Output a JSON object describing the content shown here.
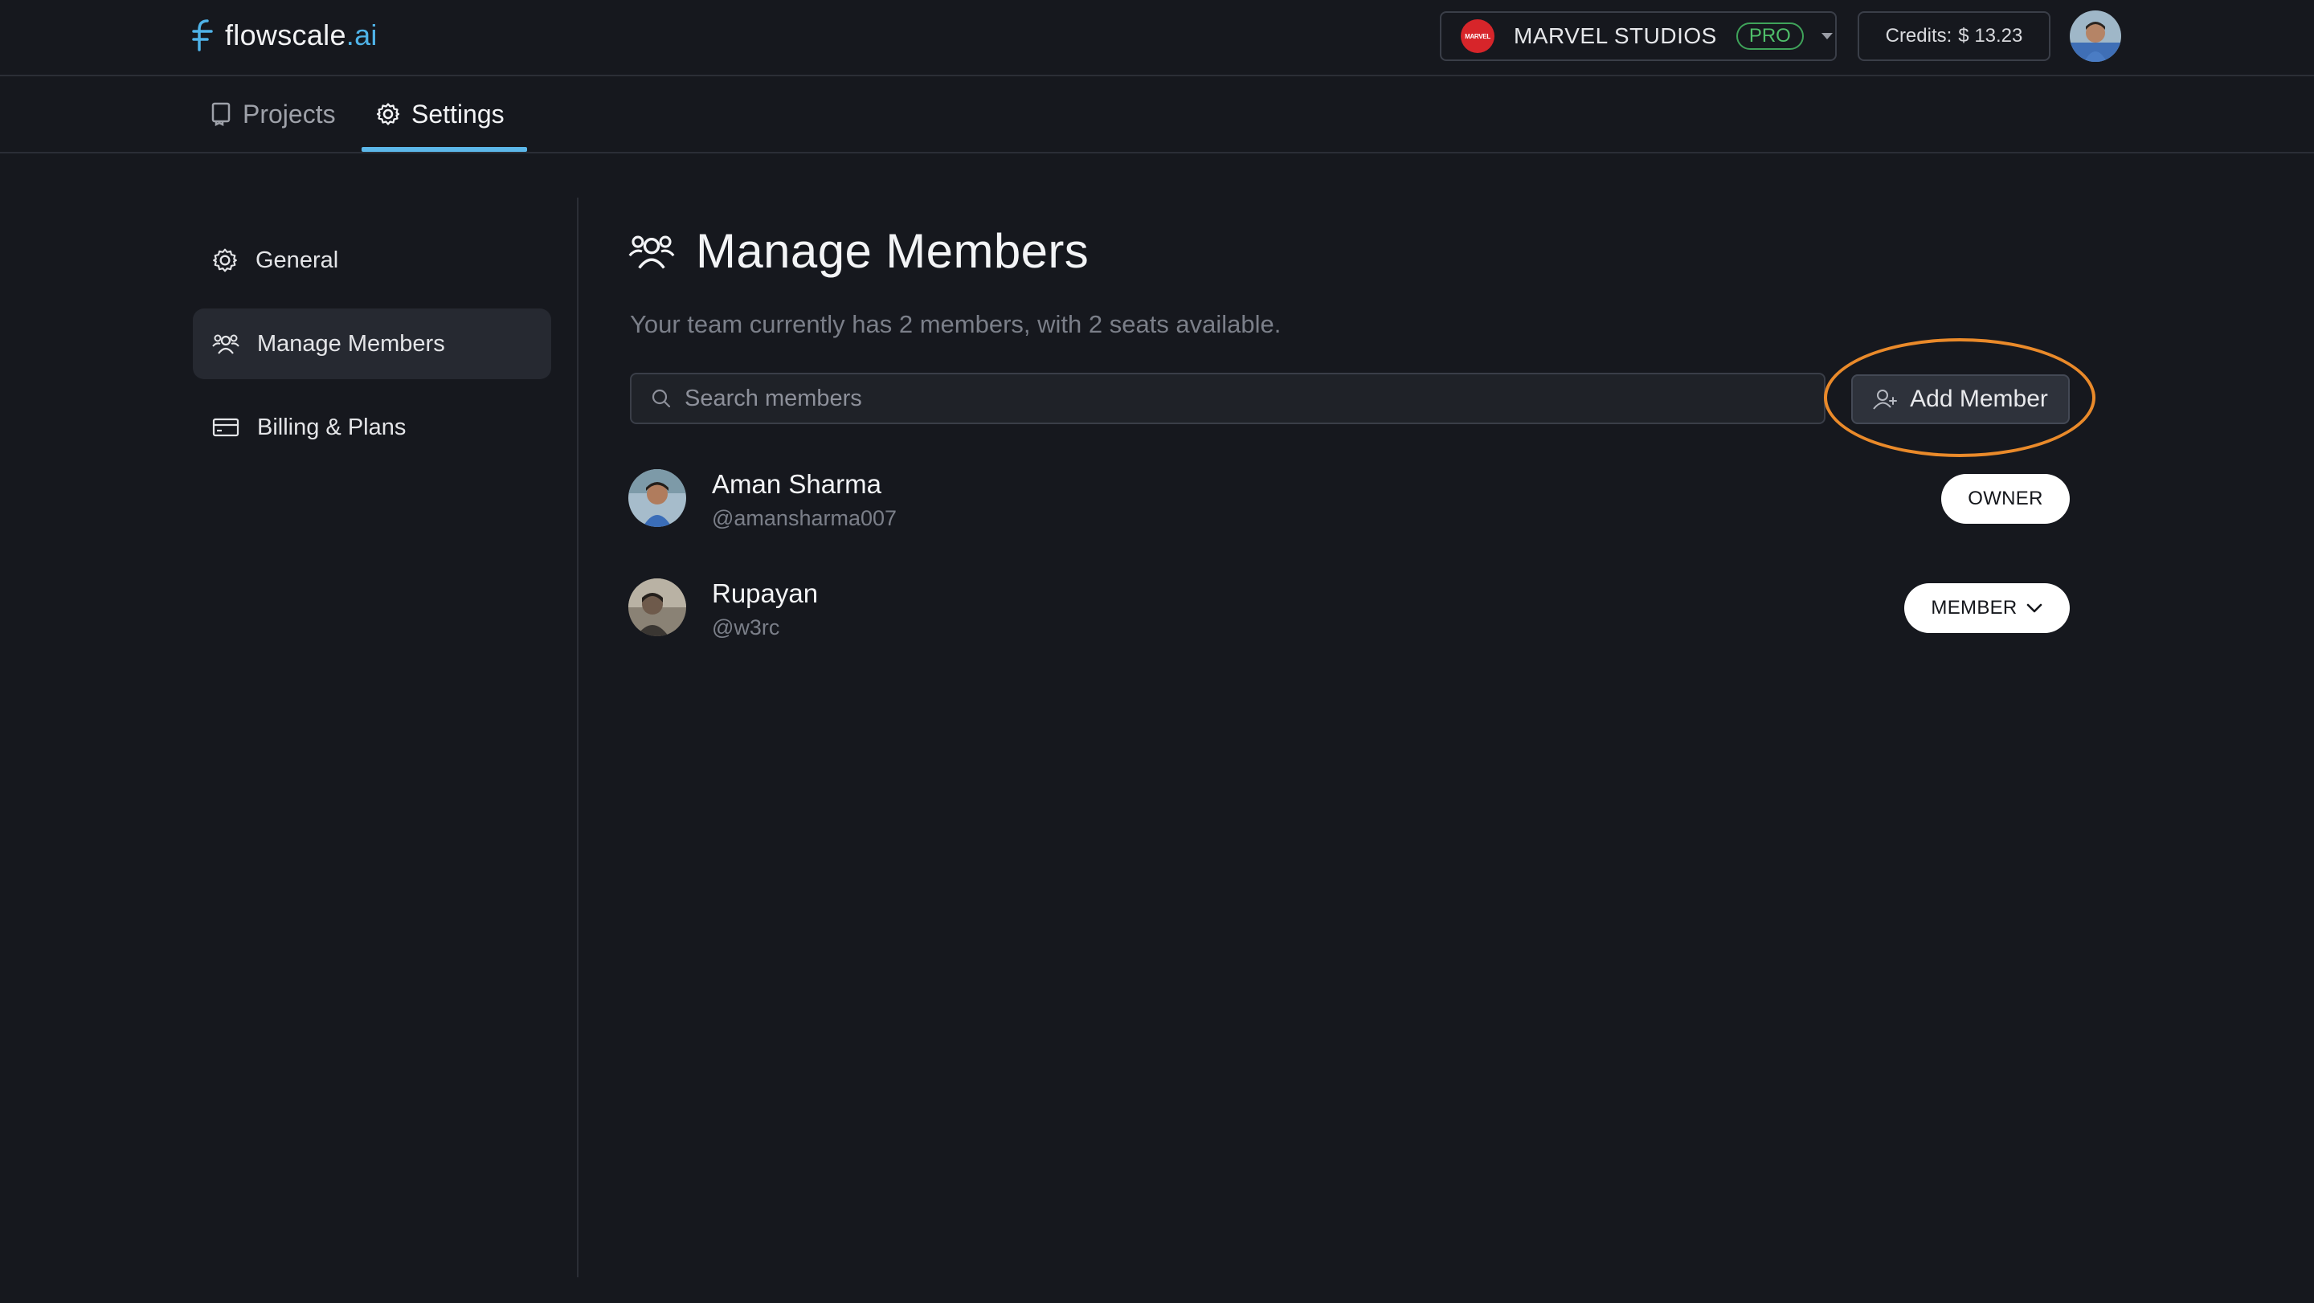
{
  "brand": {
    "name": "flowscale",
    "suffix": ".ai"
  },
  "workspace": {
    "logo_text": "MARVEL",
    "name": "MARVEL STUDIOS",
    "plan": "PRO"
  },
  "credits": {
    "label": "Credits:",
    "amount": "$ 13.23"
  },
  "tabs": [
    {
      "label": "Projects",
      "icon": "book-icon"
    },
    {
      "label": "Settings",
      "icon": "gear-icon",
      "active": true
    }
  ],
  "sidebar": {
    "items": [
      {
        "label": "General",
        "icon": "gear-icon"
      },
      {
        "label": "Manage Members",
        "icon": "users-icon",
        "active": true
      },
      {
        "label": "Billing & Plans",
        "icon": "credit-card-icon"
      }
    ]
  },
  "main": {
    "title": "Manage Members",
    "subtitle": "Your team currently has 2 members, with 2 seats available.",
    "search_placeholder": "Search members",
    "add_member_label": "Add Member",
    "members": [
      {
        "name": "Aman Sharma",
        "handle": "@amansharma007",
        "role": "OWNER"
      },
      {
        "name": "Rupayan",
        "handle": "@w3rc",
        "role": "MEMBER"
      }
    ]
  },
  "colors": {
    "accent": "#5cb7e9",
    "highlight": "#ea8a2a",
    "pro": "#4fbf6a",
    "background": "#16181e"
  }
}
